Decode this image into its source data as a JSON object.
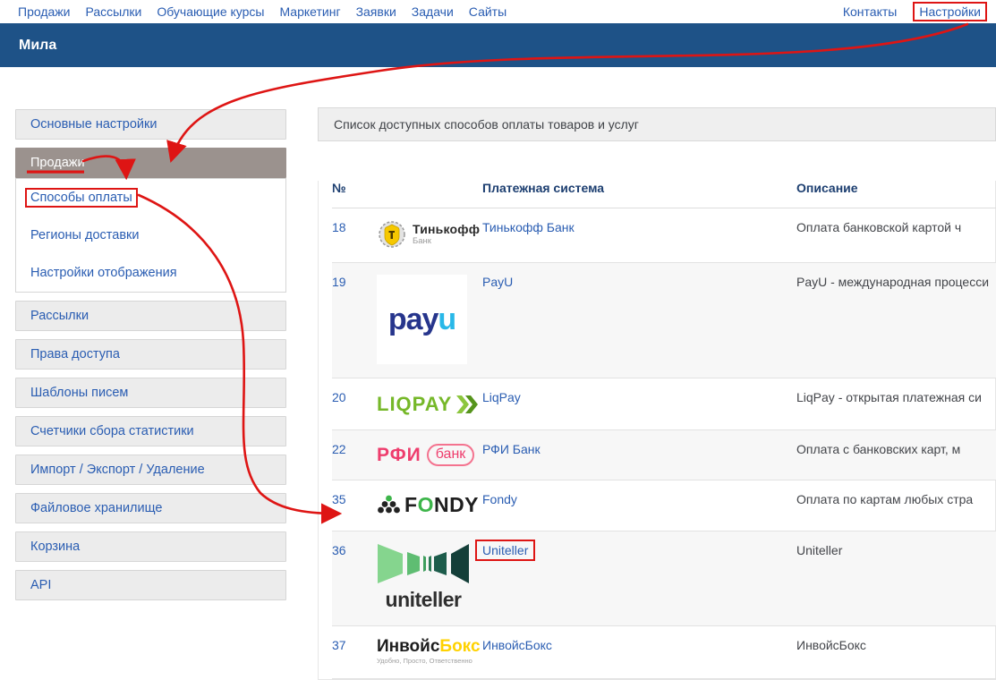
{
  "top_nav": {
    "left": [
      "Продажи",
      "Рассылки",
      "Обучающие курсы",
      "Маркетинг",
      "Заявки",
      "Задачи",
      "Сайты"
    ],
    "right": [
      {
        "label": "Контакты",
        "highlighted": false
      },
      {
        "label": "Настройки",
        "highlighted": true
      }
    ]
  },
  "titlebar": {
    "title": "Мила"
  },
  "sidebar": {
    "items": [
      {
        "label": "Основные настройки"
      },
      {
        "label": "Продажи",
        "active": true,
        "underlined": true
      },
      {
        "submenu": [
          {
            "label": "Способы оплаты",
            "framed": true
          },
          {
            "label": "Регионы доставки"
          },
          {
            "label": "Настройки отображения"
          }
        ]
      },
      {
        "label": "Рассылки"
      },
      {
        "label": "Права доступа"
      },
      {
        "label": "Шаблоны писем"
      },
      {
        "label": "Счетчики сбора статистики"
      },
      {
        "label": "Импорт / Экспорт / Удаление"
      },
      {
        "label": "Файловое хранилище"
      },
      {
        "label": "Корзина"
      },
      {
        "label": "API"
      }
    ]
  },
  "panel": {
    "title": "Список доступных способов оплаты товаров и услуг"
  },
  "payments_table": {
    "headers": [
      "№",
      "Платежная система",
      "Описание"
    ],
    "rows": [
      {
        "num": "18",
        "logo": "tinkoff",
        "name": "Тинькофф Банк",
        "desc": "Оплата банковской картой ч",
        "framed": false
      },
      {
        "num": "19",
        "logo": "payu",
        "name": "PayU",
        "desc": "PayU - международная процесси",
        "framed": false
      },
      {
        "num": "20",
        "logo": "liqpay",
        "name": "LiqPay",
        "desc": "LiqPay - открытая платежная си",
        "framed": false
      },
      {
        "num": "22",
        "logo": "rfibank",
        "name": "РФИ Банк",
        "desc": "Оплата с банковских карт, м",
        "framed": false
      },
      {
        "num": "35",
        "logo": "fondy",
        "name": "Fondy",
        "desc": "Оплата по картам любых стра",
        "framed": false
      },
      {
        "num": "36",
        "logo": "uniteller",
        "name": "Uniteller",
        "desc": "Uniteller",
        "framed": true
      },
      {
        "num": "37",
        "logo": "invoicebox",
        "name": "ИнвойсБокс",
        "desc": "ИнвойсБокс",
        "framed": false
      }
    ]
  },
  "logos": {
    "tinkoff": {
      "title": "Тинькофф",
      "subtitle": "Банк"
    },
    "payu": {
      "part1": "pay",
      "part2": "u"
    },
    "liqpay": {
      "text": "LIQPAY"
    },
    "rfibank": {
      "part1": "РФИ",
      "part2": "банк"
    },
    "fondy": {
      "p1": "F",
      "p2": "O",
      "p3": "NDY"
    },
    "uniteller": {
      "text": "uniteller"
    },
    "invoicebox": {
      "part1": "Инвойс",
      "part2": "Бокс",
      "tagline": "Удобно, Просто, Ответственно"
    }
  },
  "colors": {
    "annotation_red": "#de1514",
    "titlebar_blue": "#1e5287",
    "link_blue": "#2a5db2",
    "active_item_bg": "#9b928e",
    "table_header_navy": "#1c3e70"
  }
}
